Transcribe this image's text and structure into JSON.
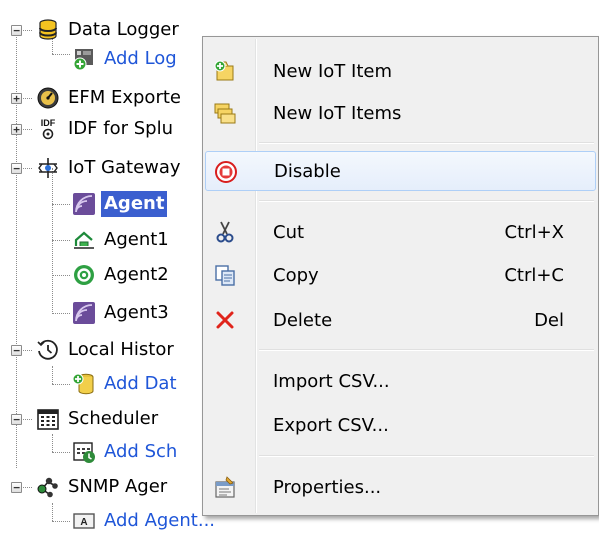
{
  "tree": {
    "nodes": [
      {
        "label": "Data Logger",
        "icon": "data-logger-icon",
        "expanded": true
      },
      {
        "label": "Add Log",
        "icon": "add-log-icon",
        "link": true
      },
      {
        "label": "EFM Exporte",
        "icon": "efm-exporter-icon",
        "expanded": false
      },
      {
        "label": "IDF for Splu",
        "icon": "idf-icon",
        "icon_text": "IDF",
        "expanded": false
      },
      {
        "label": "IoT Gateway",
        "icon": "iot-gateway-icon",
        "expanded": true
      },
      {
        "label": "Agent",
        "icon": "rest-agent-icon",
        "selected": true
      },
      {
        "label": "Agent1",
        "icon": "mqtt-agent-icon"
      },
      {
        "label": "Agent2",
        "icon": "thingworx-agent-icon"
      },
      {
        "label": "Agent3",
        "icon": "rest-agent-icon"
      },
      {
        "label": "Local Histor",
        "icon": "local-historian-icon",
        "expanded": true
      },
      {
        "label": "Add Dat",
        "icon": "add-datastore-icon",
        "link": true
      },
      {
        "label": "Scheduler",
        "icon": "scheduler-icon",
        "expanded": true
      },
      {
        "label": "Add Sch",
        "icon": "add-schedule-icon",
        "link": true
      },
      {
        "label": "SNMP Ager",
        "icon": "snmp-agent-icon",
        "expanded": true
      },
      {
        "label": "Add Agent...",
        "icon": "add-agent-icon",
        "icon_text": "A",
        "link": true
      }
    ]
  },
  "context_menu": {
    "items": [
      {
        "label": "New IoT Item",
        "icon": "new-iot-item-icon"
      },
      {
        "label": "New IoT Items",
        "icon": "new-iot-items-icon"
      },
      {
        "label": "Disable",
        "icon": "disable-icon",
        "hover": true
      },
      {
        "label": "Cut",
        "shortcut": "Ctrl+X",
        "icon": "cut-icon"
      },
      {
        "label": "Copy",
        "shortcut": "Ctrl+C",
        "icon": "copy-icon"
      },
      {
        "label": "Delete",
        "shortcut": "Del",
        "icon": "delete-icon"
      },
      {
        "label": "Import CSV...",
        "icon": ""
      },
      {
        "label": "Export CSV...",
        "icon": ""
      },
      {
        "label": "Properties...",
        "icon": "properties-icon"
      }
    ]
  },
  "colors": {
    "link": "#1f56d8",
    "selection": "#3b5fcf",
    "menu_bg": "#f0f0f0",
    "hover_border": "#aecff7",
    "delete_red": "#e0241b"
  }
}
